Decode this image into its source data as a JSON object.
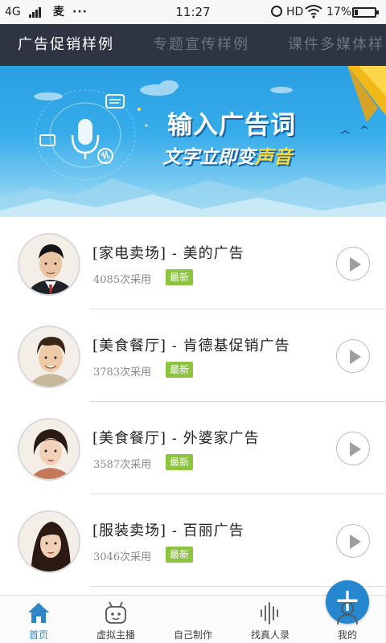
{
  "status_bar": {
    "network": "4G",
    "message_icon_label": "麦",
    "more": "···",
    "time": "11:27",
    "hd": "HD",
    "battery_pct": "17%",
    "battery_level": 0.17
  },
  "tabs": [
    {
      "label": "广告促销样例",
      "active": true
    },
    {
      "label": "专题宣传样例",
      "active": false
    },
    {
      "label": "课件多媒体样",
      "active": false
    }
  ],
  "banner": {
    "headline": "输入广告词",
    "sub_prefix": "文字立即变",
    "sub_highlight": "声音"
  },
  "ads": [
    {
      "title": "[家电卖场] - 美的广告",
      "count": "4085次采用",
      "badge": "最新",
      "avatar": "male-avatar"
    },
    {
      "title": "[美食餐厅] - 肯德基促销广告",
      "count": "3783次采用",
      "badge": "最新",
      "avatar": "male-avatar"
    },
    {
      "title": "[美食餐厅] - 外婆家广告",
      "count": "3587次采用",
      "badge": "最新",
      "avatar": "female-avatar"
    },
    {
      "title": "[服装卖场] - 百丽广告",
      "count": "3046次采用",
      "badge": "最新",
      "avatar": "female-avatar"
    }
  ],
  "bottom_nav": [
    {
      "label": "首页",
      "icon": "home-icon",
      "active": true
    },
    {
      "label": "虚拟主播",
      "icon": "robot-icon",
      "active": false
    },
    {
      "label": "自己制作",
      "icon": "plus-icon",
      "active": false
    },
    {
      "label": "找真人录",
      "icon": "waveform-icon",
      "active": false
    },
    {
      "label": "我的",
      "icon": "user-icon",
      "active": false
    }
  ],
  "fab_symbol": "+",
  "colors": {
    "tab_bar_bg": "#2e3442",
    "accent": "#2487cf",
    "badge": "#8dc43f",
    "banner_highlight": "#ffd83a"
  }
}
